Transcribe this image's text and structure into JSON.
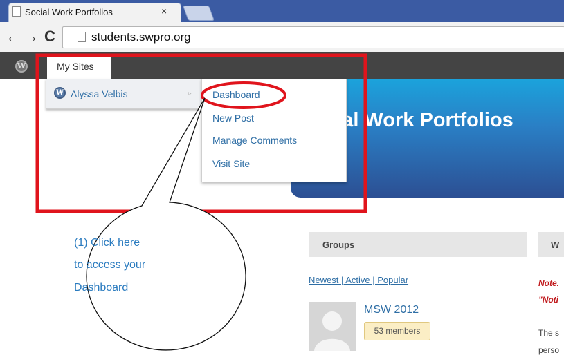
{
  "browser": {
    "tab_title": "Social Work Portfolios",
    "tab_close": "×",
    "back": "←",
    "forward": "→",
    "reload": "C",
    "url": "students.swpro.org"
  },
  "adminbar": {
    "logo": "W",
    "my_sites": "My Sites"
  },
  "sites_menu": {
    "site_icon": "W",
    "site_name": "Alyssa Velbis",
    "arrow": "▹",
    "submenu": [
      "Dashboard",
      "New Post",
      "Manage Comments",
      "Visit Site"
    ]
  },
  "header": {
    "site_title": "cial Work Portfolios",
    "banner_color": "#2a7fc5"
  },
  "groups": {
    "title": "Groups",
    "filters": "Newest | Active | Popular",
    "group_name": "MSW 2012",
    "members": "53 members"
  },
  "right_widget": {
    "title": "W",
    "note1": "Note.",
    "note2": "\"Noti",
    "body1": "The s",
    "body2": "perso"
  },
  "annotation": {
    "lines": [
      "(1) Click here",
      "to access your",
      "Dashboard"
    ],
    "highlight_color": "#e0141c"
  }
}
